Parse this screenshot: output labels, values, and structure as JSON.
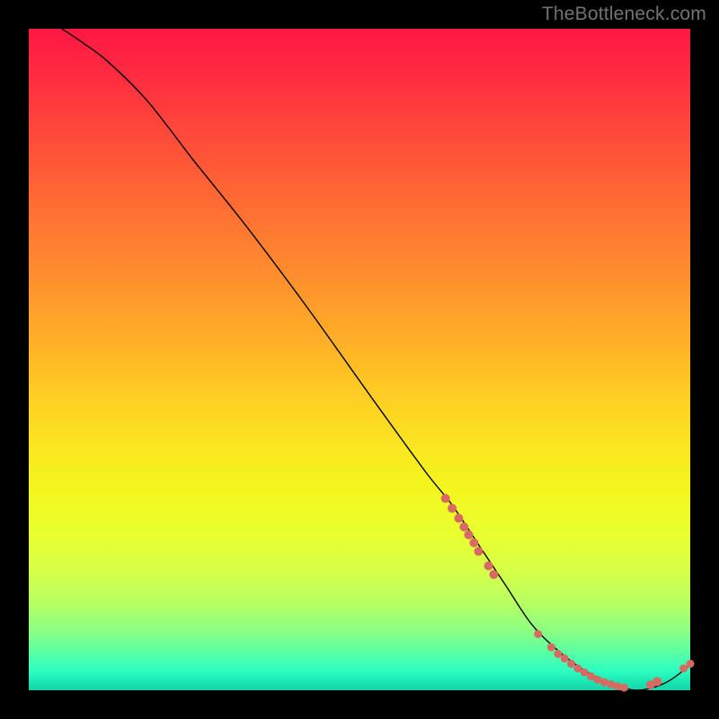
{
  "watermark": "TheBottleneck.com",
  "chart_data": {
    "type": "line",
    "title": "",
    "xlabel": "",
    "ylabel": "",
    "xlim": [
      0,
      100
    ],
    "ylim": [
      0,
      100
    ],
    "grid": false,
    "legend": false,
    "background_gradient": {
      "direction": "vertical",
      "stops": [
        {
          "pos": 0.0,
          "color": "#ff1744"
        },
        {
          "pos": 0.5,
          "color": "#ffd024"
        },
        {
          "pos": 0.78,
          "color": "#edff2c"
        },
        {
          "pos": 1.0,
          "color": "#17d3a9"
        }
      ]
    },
    "series": [
      {
        "name": "bottleneck-curve",
        "color": "#000000",
        "x": [
          5,
          8,
          12,
          18,
          25,
          33,
          42,
          52,
          60,
          64,
          68,
          72,
          76,
          80,
          84,
          88,
          92,
          96,
          99,
          100
        ],
        "y": [
          100,
          98,
          95,
          89,
          80,
          70,
          58,
          44,
          33,
          28,
          22,
          16,
          10,
          6,
          3,
          1,
          0,
          1,
          3,
          4
        ]
      }
    ],
    "markers": [
      {
        "name": "left-cluster",
        "color": "#d76a63",
        "radius": 5,
        "points": [
          {
            "x": 63,
            "y": 29
          },
          {
            "x": 64,
            "y": 27.5
          },
          {
            "x": 65,
            "y": 26
          },
          {
            "x": 65.8,
            "y": 24.7
          },
          {
            "x": 66.5,
            "y": 23.5
          },
          {
            "x": 67.3,
            "y": 22.3
          },
          {
            "x": 68,
            "y": 21
          },
          {
            "x": 69.5,
            "y": 18.8
          },
          {
            "x": 70.3,
            "y": 17.5
          }
        ]
      },
      {
        "name": "valley-cluster",
        "color": "#d76a63",
        "radius": 4.5,
        "points": [
          {
            "x": 77,
            "y": 8.5
          },
          {
            "x": 79,
            "y": 6.5
          },
          {
            "x": 80,
            "y": 5.5
          },
          {
            "x": 81,
            "y": 4.8
          },
          {
            "x": 82,
            "y": 4
          },
          {
            "x": 83,
            "y": 3.3
          },
          {
            "x": 84,
            "y": 2.7
          },
          {
            "x": 85,
            "y": 2.1
          },
          {
            "x": 86,
            "y": 1.6
          },
          {
            "x": 87,
            "y": 1.2
          },
          {
            "x": 88,
            "y": 0.9
          },
          {
            "x": 89,
            "y": 0.6
          },
          {
            "x": 90,
            "y": 0.4
          }
        ]
      },
      {
        "name": "right-cluster",
        "color": "#d76a63",
        "radius": 5,
        "points": [
          {
            "x": 94,
            "y": 0.8
          },
          {
            "x": 95,
            "y": 1.3
          }
        ]
      },
      {
        "name": "tip-cluster",
        "color": "#d76a63",
        "radius": 4.5,
        "points": [
          {
            "x": 99,
            "y": 3.3
          },
          {
            "x": 100,
            "y": 4
          }
        ]
      }
    ]
  }
}
